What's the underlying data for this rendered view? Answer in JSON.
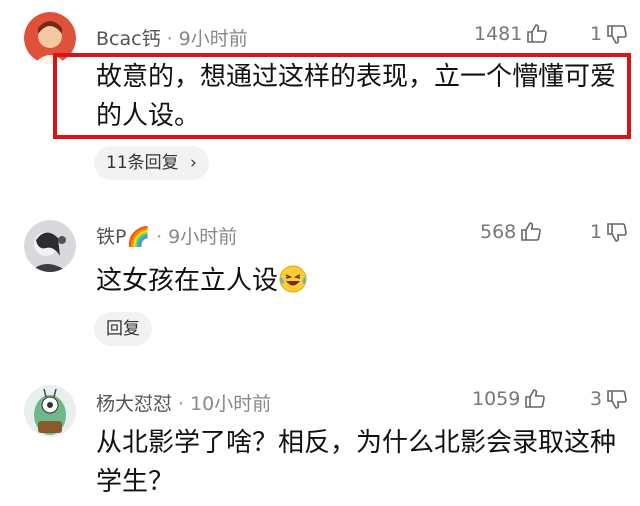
{
  "comments": [
    {
      "user": "Bcac钙",
      "time": "9小时前",
      "likes": "1481",
      "dislikes": "1",
      "text": "故意的，想通过这样的表现，立一个懵懂可爱的人设。",
      "reply_label": "11条回复",
      "reply_chevron": "›",
      "highlighted": true,
      "highlight_color": "#d81414"
    },
    {
      "user": "铁P🌈",
      "time": "9小时前",
      "likes": "568",
      "dislikes": "1",
      "text": "这女孩在立人设",
      "emoji": "laughing-crying-face",
      "reply_label": "回复"
    },
    {
      "user": "杨大怼怼",
      "time": "10小时前",
      "likes": "1059",
      "dislikes": "3",
      "text": "从北影学了啥？相反，为什么北影会录取这种学生？"
    }
  ],
  "icons": {
    "like": "thumbs-up-icon",
    "dislike": "thumbs-down-icon"
  }
}
